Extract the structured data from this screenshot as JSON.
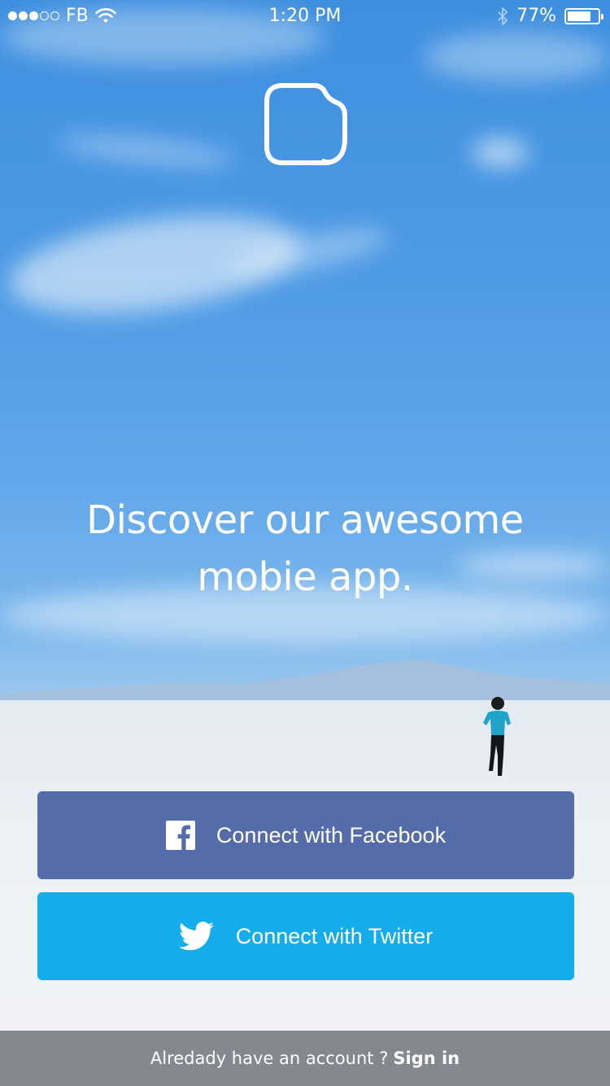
{
  "status_bar": {
    "carrier": "FB",
    "time": "1:20 PM",
    "battery_percent": "77%",
    "battery_level": 0.77,
    "signal_bars": 3,
    "signal_total": 5
  },
  "headline": {
    "line1": "Discover our awesome",
    "line2": "mobie app."
  },
  "buttons": {
    "facebook_label": "Connect with Facebook",
    "twitter_label": "Connect with Twitter"
  },
  "footer": {
    "prompt": "Alredady have an account ?",
    "signin_label": "Sign in"
  },
  "colors": {
    "facebook": "#546ca9",
    "twitter": "#14aceb"
  },
  "icons": [
    "wifi-icon",
    "bluetooth-icon",
    "battery-icon",
    "app-logo-icon",
    "facebook-icon",
    "twitter-icon"
  ]
}
